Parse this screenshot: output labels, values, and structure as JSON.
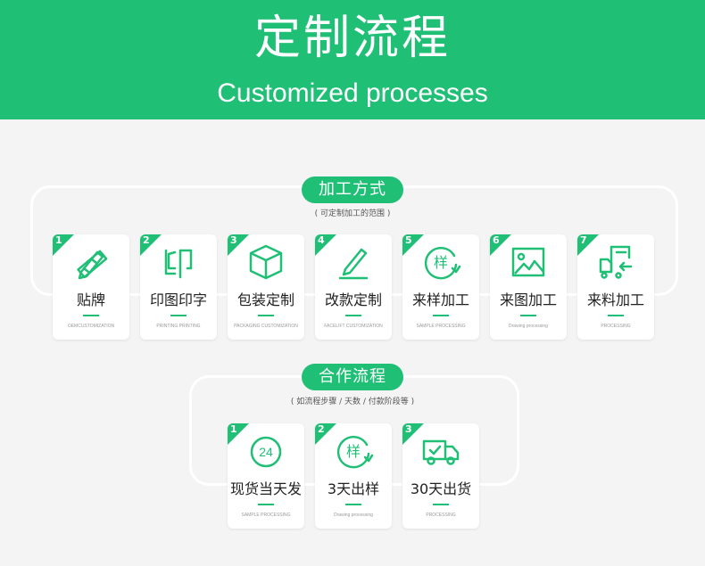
{
  "header": {
    "title_cn": "定制流程",
    "title_en": "Customized processes"
  },
  "colors": {
    "brand": "#20bf76"
  },
  "section1": {
    "title": "加工方式",
    "subtitle": "( 可定制加工的范围 )",
    "cards": [
      {
        "num": "1",
        "icon": "pencil-ruler-icon",
        "title": "贴牌",
        "sub": "OEMCUSTOMIZATION"
      },
      {
        "num": "2",
        "icon": "print-stamp-icon",
        "title": "印图印字",
        "sub": "PRINTING PRINTING"
      },
      {
        "num": "3",
        "icon": "package-box-icon",
        "title": "包装定制",
        "sub": "PACKAGING CUSTOMIZATION"
      },
      {
        "num": "4",
        "icon": "edit-pen-icon",
        "title": "改款定制",
        "sub": "FACELIFT CUSTOMIZATION"
      },
      {
        "num": "5",
        "icon": "sample-cycle-icon",
        "title": "来样加工",
        "sub": "SAMPLE PROCESSING"
      },
      {
        "num": "6",
        "icon": "image-icon",
        "title": "来图加工",
        "sub": "Drawing processing"
      },
      {
        "num": "7",
        "icon": "material-list-icon",
        "title": "来料加工",
        "sub": "PROCESSING"
      }
    ]
  },
  "section2": {
    "title": "合作流程",
    "subtitle": "( 如流程步骤 / 天数 / 付款阶段等 )",
    "cards": [
      {
        "num": "1",
        "icon": "24h-icon",
        "title": "现货当天发",
        "sub": "SAMPLE PROCESSING"
      },
      {
        "num": "2",
        "icon": "sample-cycle-icon",
        "title": "3天出样",
        "sub": "Drawing processing"
      },
      {
        "num": "3",
        "icon": "delivery-truck-icon",
        "title": "30天出货",
        "sub": "PROCESSING"
      }
    ]
  },
  "glyphs": {
    "sample_char": "样",
    "hours": "24"
  }
}
